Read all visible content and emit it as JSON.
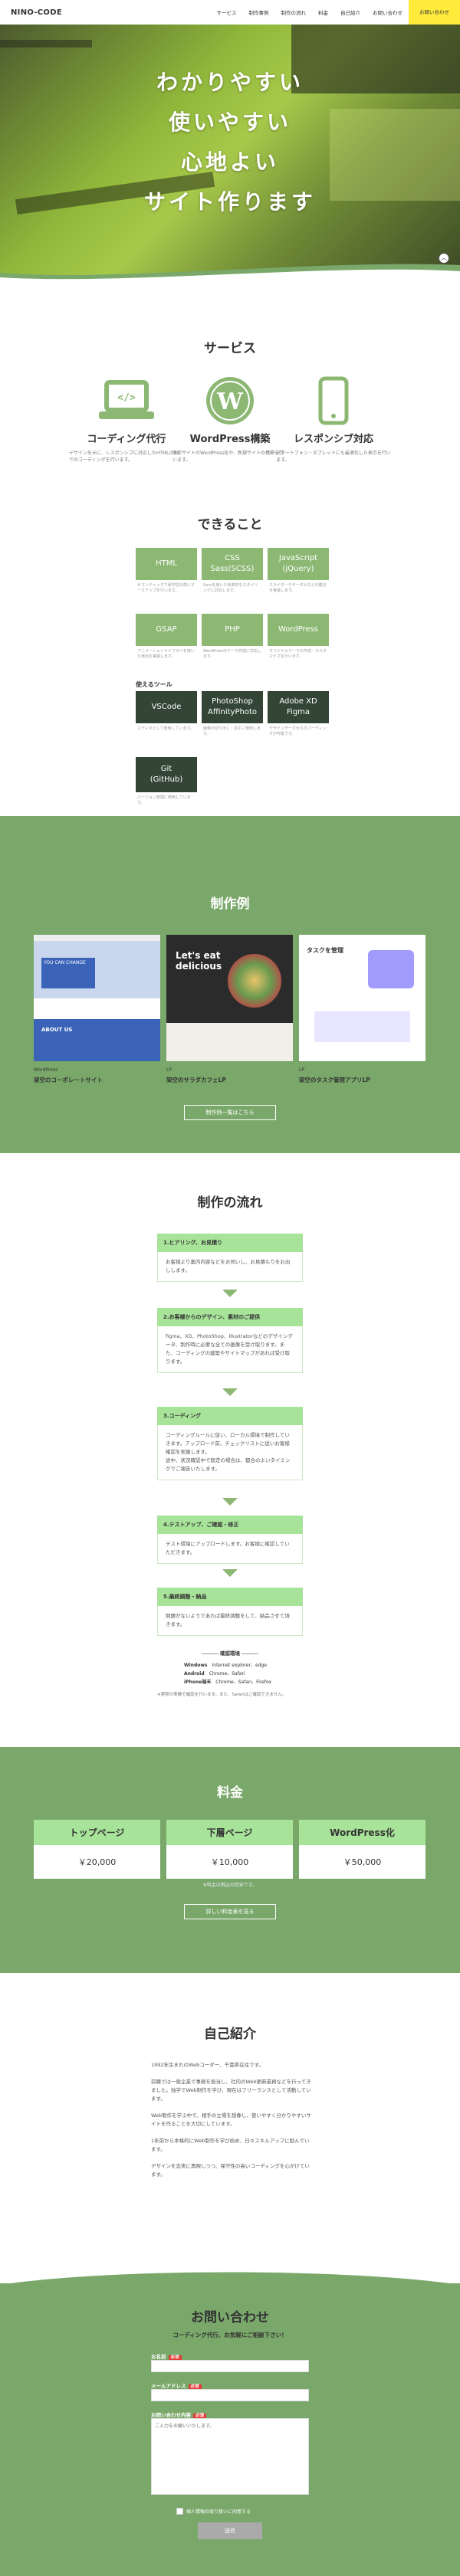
{
  "header": {
    "logo": "NINO-CODE",
    "nav": [
      "サービス",
      "制作事例",
      "制作の流れ",
      "料金",
      "自己紹介"
    ],
    "contact_link": "お問い合わせ",
    "cta": "お問い合わせ"
  },
  "hero": {
    "lines": [
      "わかりやすい",
      "使いやすい",
      "心地よい",
      "サイト作ります"
    ],
    "scroll_icon": "chevron-up-icon"
  },
  "services": {
    "title": "サービス",
    "items": [
      {
        "icon": "laptop-code-icon",
        "title": "コーディング代行",
        "desc": "デザインを元に、レスポンシブに対応したHTML/CSSでのコーディングを行います。"
      },
      {
        "icon": "wordpress-icon",
        "title": "WordPress構築",
        "desc": "既存サイトのWordPress化や、新規サイトの構築を行います。"
      },
      {
        "icon": "smartphone-icon",
        "title": "レスポンシブ対応",
        "desc": "スマートフォン・タブレットにも最適化した表示を行います。"
      }
    ]
  },
  "skills": {
    "title": "できること",
    "items": [
      {
        "label": "HTML",
        "desc": "セマンティックで保守性の高いマークアップを行います。"
      },
      {
        "label": "CSS\nSass(SCSS)",
        "desc": "Sassを用いた効率的なスタイリングに対応します。"
      },
      {
        "label": "JavaScript\n(jQuery)",
        "desc": "スライダーやモーダルなどの動きを実装します。"
      },
      {
        "label": "GSAP",
        "desc": "アニメーションライブラリを用いた演出を実装します。"
      },
      {
        "label": "PHP",
        "desc": "WordPressのテーマ作成に対応します。"
      },
      {
        "label": "WordPress",
        "desc": "オリジナルテーマの作成・カスタマイズを行います。"
      }
    ],
    "tools_title": "使えるツール",
    "tools": [
      {
        "label": "VSCode",
        "desc": "エディタとして使用しています。"
      },
      {
        "label": "PhotoShop\nAffinityPhoto",
        "desc": "画像の切り出し・加工に使用します。"
      },
      {
        "label": "Adobe XD\nFigma",
        "desc": "デザインデータからのコーディングが可能です。"
      },
      {
        "label": "Git\n(GitHub)",
        "desc": "バージョン管理に使用しています。"
      }
    ]
  },
  "works": {
    "title": "制作例",
    "items": [
      {
        "tag": "WordPress",
        "name": "架空のコーポレートサイト",
        "thumb_color": "#3b63b8"
      },
      {
        "tag": "LP",
        "name": "架空のサラダカフェLP",
        "thumb_color": "#2b2b2b"
      },
      {
        "tag": "LP",
        "name": "架空のタスク管理アプリLP",
        "thumb_color": "#a29bfe"
      }
    ],
    "more_button": "制作例一覧はこちら",
    "thumb_texts": [
      "YOU CAN CHANGE",
      "ABOUT US",
      "Let's eat delicious",
      "タスクを管理"
    ]
  },
  "flow": {
    "title": "制作の流れ",
    "steps": [
      {
        "title": "1.ヒアリング、お見積り",
        "text": "お客様より案内内容などをお伺いし、お見積もりをお出しします。"
      },
      {
        "title": "2.お客様からのデザイン、素材のご提供",
        "text": "figma、XD、PhotoShop、Illustratorなどのデザインデータ、制作時に必要な全ての画像を受け取ります。また、コーディングの建築やサイトマップがあれば受け取ります。"
      },
      {
        "title": "3.コーディング",
        "text": "コーディングルールに従い、ローカル環境で制作していきます。アップロード前、チェックリストに従いお客様確認を実施します。\n途中、状況確認中で既定の場合は、都合のよいタイミングでご報告いたします。"
      },
      {
        "title": "4.テストアップ、ご確認・修正",
        "text": "テスト環境にアップロードします。お客様に確認していただきます。"
      },
      {
        "title": "5.最終調整・納品",
        "text": "問題がないようであれば最終調整をして、納品させて頂きます。"
      }
    ],
    "env_title": "確認環境",
    "env": [
      {
        "os": "Windows",
        "browsers": "Internet explorer、edge"
      },
      {
        "os": "Android",
        "browsers": "Chrome、Safari"
      },
      {
        "os": "iPhone端末",
        "browsers": "Chrome、Safari、Firefox"
      }
    ],
    "env_note": "※実際の実機で確認を行います。また、Safariはご確認できません。"
  },
  "price": {
    "title": "料金",
    "items": [
      {
        "name": "トップページ",
        "value": "￥20,000"
      },
      {
        "name": "下層ページ",
        "value": "￥10,000"
      },
      {
        "name": "WordPress化",
        "value": "￥50,000"
      }
    ],
    "note": "※料金は税込の目安です。",
    "button": "詳しい料金表を見る"
  },
  "profile": {
    "title": "自己紹介",
    "paragraphs": [
      "1992年生まれのWebコーダー、千葉県在住です。",
      "前職では一般企業で事務を担当し、社内のWeb更新業務などを行ってきました。独学でWeb制作を学び、現在はフリーランスとして活動しています。",
      "Web制作を学ぶ中で、相手の立場を想像し、使いやすく分かりやすいサイトを作ることを大切にしています。",
      "1年前から本格的にWeb制作を学び始め、日々スキルアップに励んでいます。",
      "デザインを忠実に再現しつつ、保守性の高いコーディングを心がけています。"
    ]
  },
  "contact": {
    "title": "お問い合わせ",
    "lead": "コーディング代行、お気軽にご相談下さい！",
    "fields": [
      {
        "label": "お名前",
        "required": "必須",
        "placeholder": ""
      },
      {
        "label": "メールアドレス",
        "required": "必須",
        "placeholder": ""
      },
      {
        "label": "お問い合わせ内容",
        "required": "必須",
        "placeholder": "ご入力をお願いいたします。"
      }
    ],
    "privacy": "個人情報の取り扱いに同意する",
    "submit": "送信"
  }
}
